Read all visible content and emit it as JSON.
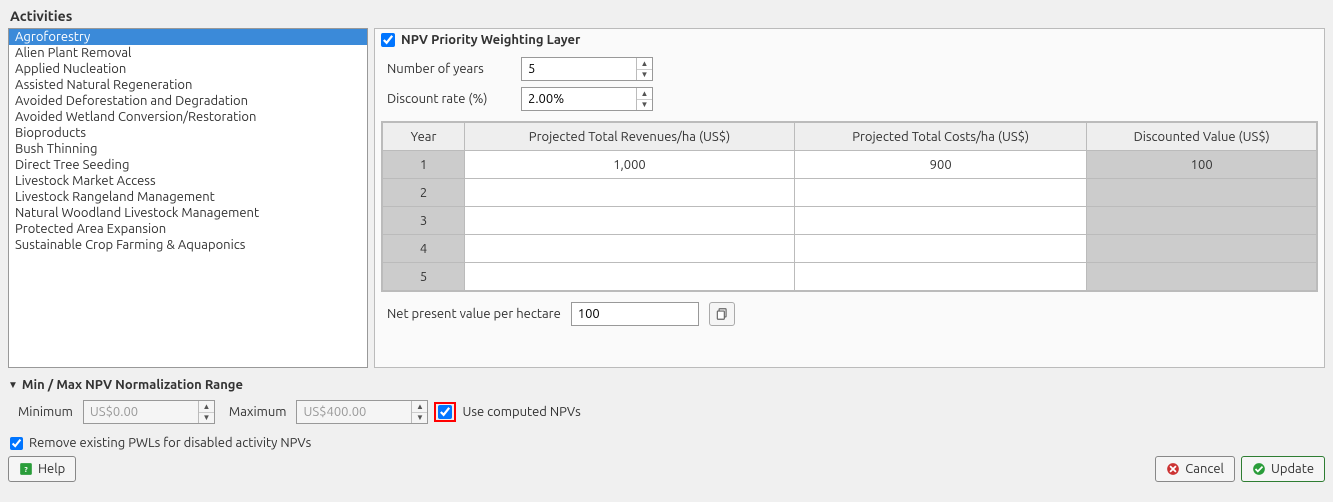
{
  "sections": {
    "activities_label": "Activities",
    "norm_label": "Min / Max NPV Normalization Range"
  },
  "activities": {
    "items": [
      "Agroforestry",
      "Alien Plant Removal",
      "Applied Nucleation",
      "Assisted Natural Regeneration",
      "Avoided Deforestation and Degradation",
      "Avoided Wetland Conversion/Restoration",
      "Bioproducts",
      "Bush Thinning",
      "Direct Tree Seeding",
      "Livestock Market Access",
      "Livestock Rangeland Management",
      "Natural Woodland Livestock Management",
      "Protected Area Expansion",
      "Sustainable Crop Farming & Aquaponics"
    ],
    "selected_index": 0
  },
  "npv_panel": {
    "header_label": "NPV Priority Weighting Layer",
    "header_checked": true,
    "num_years_label": "Number of years",
    "num_years_value": "5",
    "discount_label": "Discount rate (%)",
    "discount_value": "2.00%",
    "table": {
      "headers": [
        "Year",
        "Projected Total Revenues/ha (US$)",
        "Projected Total Costs/ha (US$)",
        "Discounted Value (US$)"
      ],
      "rows": [
        {
          "year": "1",
          "rev": "1,000",
          "cost": "900",
          "disc": "100"
        },
        {
          "year": "2",
          "rev": "",
          "cost": "",
          "disc": ""
        },
        {
          "year": "3",
          "rev": "",
          "cost": "",
          "disc": ""
        },
        {
          "year": "4",
          "rev": "",
          "cost": "",
          "disc": ""
        },
        {
          "year": "5",
          "rev": "",
          "cost": "",
          "disc": ""
        }
      ]
    },
    "npv_label": "Net present value per hectare",
    "npv_value": "100"
  },
  "norm": {
    "min_label": "Minimum",
    "min_value": "US$0.00",
    "max_label": "Maximum",
    "max_value": "US$400.00",
    "use_computed_label": "Use computed NPVs",
    "use_computed_checked": true
  },
  "remove_pwl": {
    "label": "Remove existing PWLs for disabled activity NPVs",
    "checked": true
  },
  "buttons": {
    "help": "Help",
    "cancel": "Cancel",
    "update": "Update"
  }
}
